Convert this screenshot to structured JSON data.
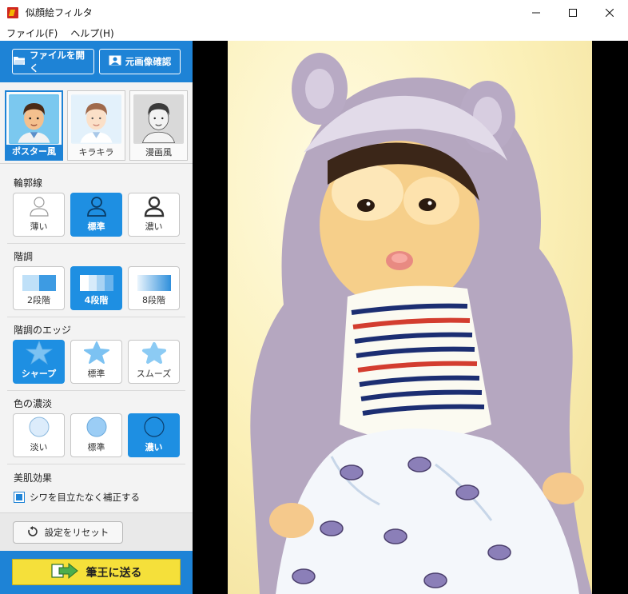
{
  "window": {
    "title": "似顔絵フィルタ",
    "minimize_icon": "minimize-icon",
    "maximize_icon": "maximize-icon",
    "close_icon": "close-icon"
  },
  "menu": {
    "items": [
      {
        "label": "ファイル(F)"
      },
      {
        "label": "ヘルプ(H)"
      }
    ]
  },
  "toolbar": {
    "open_file_label": "ファイルを開く",
    "open_file_icon": "folder-open-icon",
    "view_original_label": "元画像確認",
    "view_original_icon": "image-icon",
    "accent_color": "#1e83d6"
  },
  "presets": [
    {
      "label": "ポスター風",
      "selected": true
    },
    {
      "label": "キラキラ",
      "selected": false
    },
    {
      "label": "漫画風",
      "selected": false
    }
  ],
  "sections": {
    "outline": {
      "title": "輪郭線",
      "options": [
        {
          "label": "薄い",
          "icon": "person-icon",
          "selected": false
        },
        {
          "label": "標準",
          "icon": "person-icon",
          "selected": true
        },
        {
          "label": "濃い",
          "icon": "person-icon",
          "selected": false
        }
      ]
    },
    "gradation": {
      "title": "階調",
      "options": [
        {
          "label": "2段階",
          "icon": "gradient-2-icon",
          "selected": false
        },
        {
          "label": "4段階",
          "icon": "gradient-4-icon",
          "selected": true
        },
        {
          "label": "8段階",
          "icon": "gradient-8-icon",
          "selected": false
        }
      ]
    },
    "edge": {
      "title": "階調のエッジ",
      "options": [
        {
          "label": "シャープ",
          "icon": "star-sharp-icon",
          "selected": true
        },
        {
          "label": "標準",
          "icon": "star-icon",
          "selected": false
        },
        {
          "label": "スムーズ",
          "icon": "star-smooth-icon",
          "selected": false
        }
      ]
    },
    "color": {
      "title": "色の濃淡",
      "options": [
        {
          "label": "淡い",
          "icon": "circle-light-icon",
          "selected": false
        },
        {
          "label": "標準",
          "icon": "circle-icon",
          "selected": false
        },
        {
          "label": "濃い",
          "icon": "circle-dark-icon",
          "selected": true
        }
      ]
    },
    "skin": {
      "title": "美肌効果",
      "checkbox_label": "シワを目立たなく補正する",
      "checked": true
    }
  },
  "reset": {
    "label": "設定をリセット",
    "icon": "reset-icon"
  },
  "send": {
    "label": "筆王に送る",
    "icon": "send-arrow-icon",
    "button_color": "#f5e03a"
  }
}
